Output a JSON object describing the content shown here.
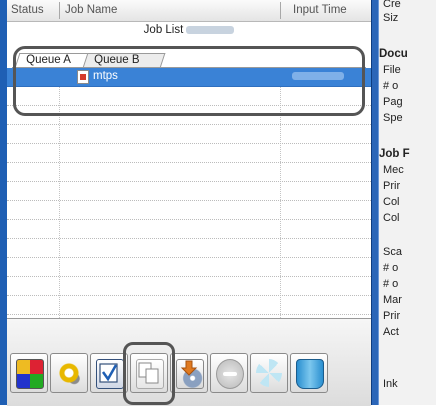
{
  "columns": {
    "status": "Status",
    "job_name": "Job Name",
    "input_time": "Input Time"
  },
  "job_list_title": "Job List",
  "tabs": [
    {
      "label": "Queue A"
    },
    {
      "label": "Queue B"
    }
  ],
  "jobs": [
    {
      "name": "mtps"
    }
  ],
  "toolbar": {
    "buttons": [
      {
        "icon": "color-settings-icon"
      },
      {
        "icon": "gear-settings-icon"
      },
      {
        "icon": "verify-document-icon"
      },
      {
        "icon": "copy-pages-icon"
      },
      {
        "icon": "save-to-disc-icon"
      },
      {
        "icon": "stop-icon"
      },
      {
        "icon": "processing-spinner-icon"
      },
      {
        "icon": "trash-icon"
      }
    ]
  },
  "info_panel": {
    "items": [
      {
        "text": "Cre",
        "bold": false
      },
      {
        "text": "Siz",
        "bold": false
      },
      {
        "text": "Docu",
        "bold": true
      },
      {
        "text": "File",
        "bold": false
      },
      {
        "text": "# o",
        "bold": false
      },
      {
        "text": "Pag",
        "bold": false
      },
      {
        "text": "Spe",
        "bold": false
      },
      {
        "text": "Job F",
        "bold": true
      },
      {
        "text": "Mec",
        "bold": false
      },
      {
        "text": "Prir",
        "bold": false
      },
      {
        "text": "Col",
        "bold": false
      },
      {
        "text": "Col",
        "bold": false
      },
      {
        "text": "Sca",
        "bold": false
      },
      {
        "text": "# o",
        "bold": false
      },
      {
        "text": "# o",
        "bold": false
      },
      {
        "text": "Mar",
        "bold": false
      },
      {
        "text": "Prir",
        "bold": false
      },
      {
        "text": "Act",
        "bold": false
      },
      {
        "text": "Ink",
        "bold": false
      }
    ]
  }
}
